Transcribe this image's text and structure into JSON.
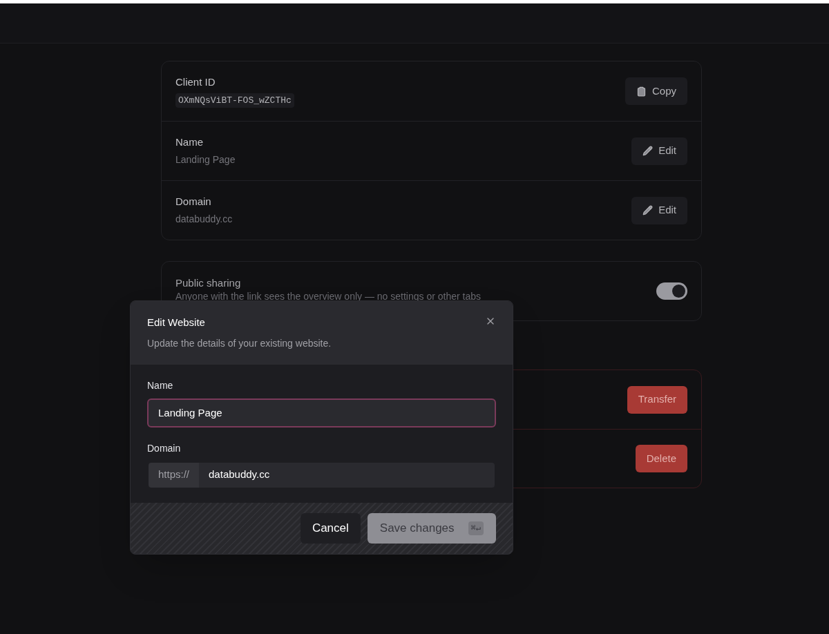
{
  "details": [
    {
      "kind": "id",
      "label": "Client ID",
      "value": "OXmNQsViBT-FOS_wZCTHc",
      "action": "Copy"
    },
    {
      "kind": "text",
      "label": "Name",
      "value": "Landing Page",
      "action": "Edit"
    },
    {
      "kind": "text",
      "label": "Domain",
      "value": "databuddy.cc",
      "action": "Edit"
    }
  ],
  "sharing": {
    "label": "Public sharing",
    "description": "Anyone with the link sees the overview only — no settings or other tabs",
    "on": true
  },
  "danger_actions": [
    "Transfer",
    "Delete"
  ],
  "dialog": {
    "title": "Edit Website",
    "subtitle": "Update the details of your existing website.",
    "fields": [
      {
        "kind": "text",
        "label": "Name",
        "value": "Landing Page",
        "focused": true
      },
      {
        "kind": "url",
        "label": "Domain",
        "prefix": "https://",
        "value": "databuddy.cc",
        "focused": false
      }
    ],
    "cancel": "Cancel",
    "save": {
      "label": "Save changes",
      "shortcut": "⌘↵",
      "disabled": true
    }
  }
}
